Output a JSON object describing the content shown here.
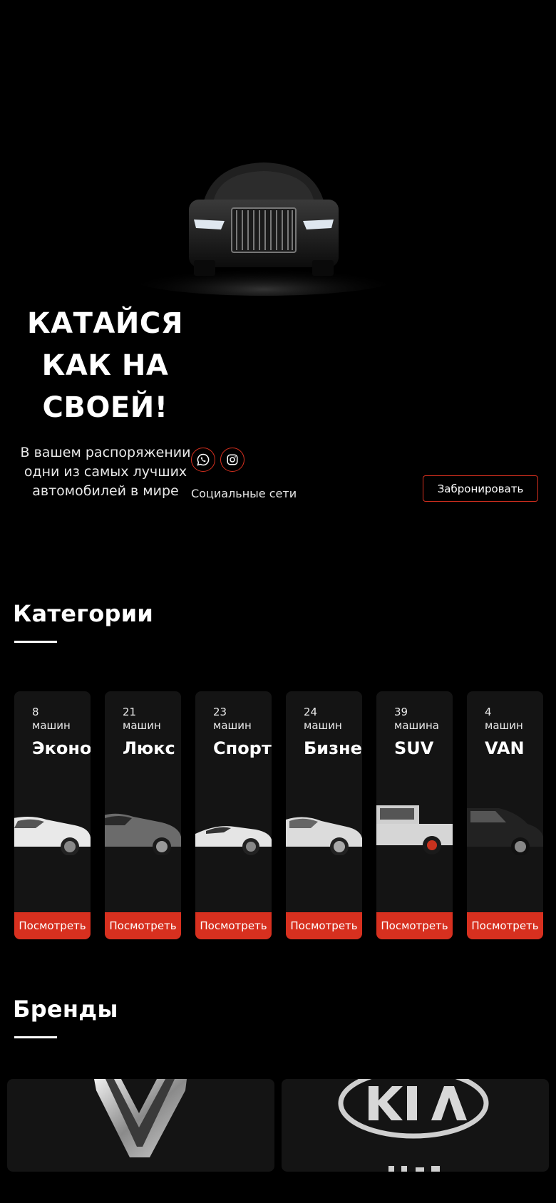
{
  "hero": {
    "title_lines": [
      "КАТАЙСЯ",
      "КАК НА",
      "СВОЕЙ!"
    ],
    "subtitle_lines": [
      "В вашем распоряжении",
      "одни из самых лучших",
      "автомобилей в мире"
    ],
    "social_label": "Социальные сети",
    "social_icons": [
      "whatsapp-icon",
      "instagram-icon"
    ],
    "book_label": "Забронировать"
  },
  "categories": {
    "title": "Категории",
    "items": [
      {
        "count": "8\nмашин",
        "name": "Эконом",
        "button": "Посмотреть"
      },
      {
        "count": "21\nмашин",
        "name": "Люкс",
        "button": "Посмотреть"
      },
      {
        "count": "23\nмашин",
        "name": "Спорт",
        "button": "Посмотреть"
      },
      {
        "count": "24\nмашин",
        "name": "Бизнес",
        "button": "Посмотреть"
      },
      {
        "count": "39\nмашина",
        "name": "SUV",
        "button": "Посмотреть"
      },
      {
        "count": "4\nмашин",
        "name": "VAN",
        "button": "Посмотреть"
      }
    ]
  },
  "brands": {
    "title": "Бренды",
    "items": [
      "renault-logo",
      "kia-logo"
    ]
  },
  "colors": {
    "accent": "#d7301f",
    "background": "#000000",
    "card": "#141414"
  }
}
